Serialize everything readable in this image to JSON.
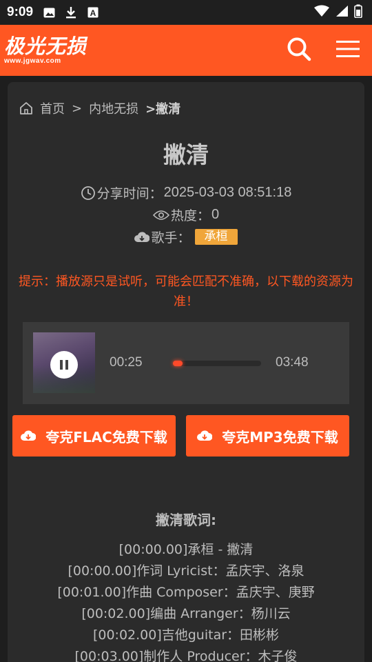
{
  "status_bar": {
    "time": "9:09",
    "icons": [
      "image-icon",
      "download-icon",
      "font-icon"
    ],
    "right_icons": [
      "wifi-icon",
      "signal-icon",
      "battery-icon"
    ]
  },
  "header": {
    "logo_main": "极光无损",
    "logo_sub": "www.jgwav.com",
    "brand_color": "#ff5722",
    "icons": [
      "search-icon",
      "menu-icon"
    ]
  },
  "breadcrumb": {
    "home": "首页",
    "sep1": ">",
    "category": "内地无损",
    "current": ">撇清"
  },
  "song": {
    "title": "撇清",
    "share_label": "分享时间：",
    "share_time": "2025-03-03 08:51:18",
    "heat_label": "热度：",
    "heat_value": "0",
    "singer_label": "歌手：",
    "singer": "承桓"
  },
  "notice": "提示：播放源只是试听，可能会匹配不准确，以下载的资源为准！",
  "player": {
    "current_time": "00:25",
    "total_time": "03:48",
    "progress": 0.11
  },
  "downloads": {
    "flac_label": "夸克FLAC免费下载",
    "mp3_label": "夸克MP3免费下载"
  },
  "lyrics": {
    "title": "撇清歌词:",
    "lines": [
      "[00:00.00]承桓 - 撇清",
      "[00:00.00]作词 Lyricist：孟庆宇、洛泉",
      "[00:01.00]作曲 Composer：孟庆宇、庚野",
      "[00:02.00]编曲 Arranger：杨川云",
      "[00:02.00]吉他guitar：田彬彬",
      "[00:03.00]制作人 Producer：木子俊"
    ]
  }
}
